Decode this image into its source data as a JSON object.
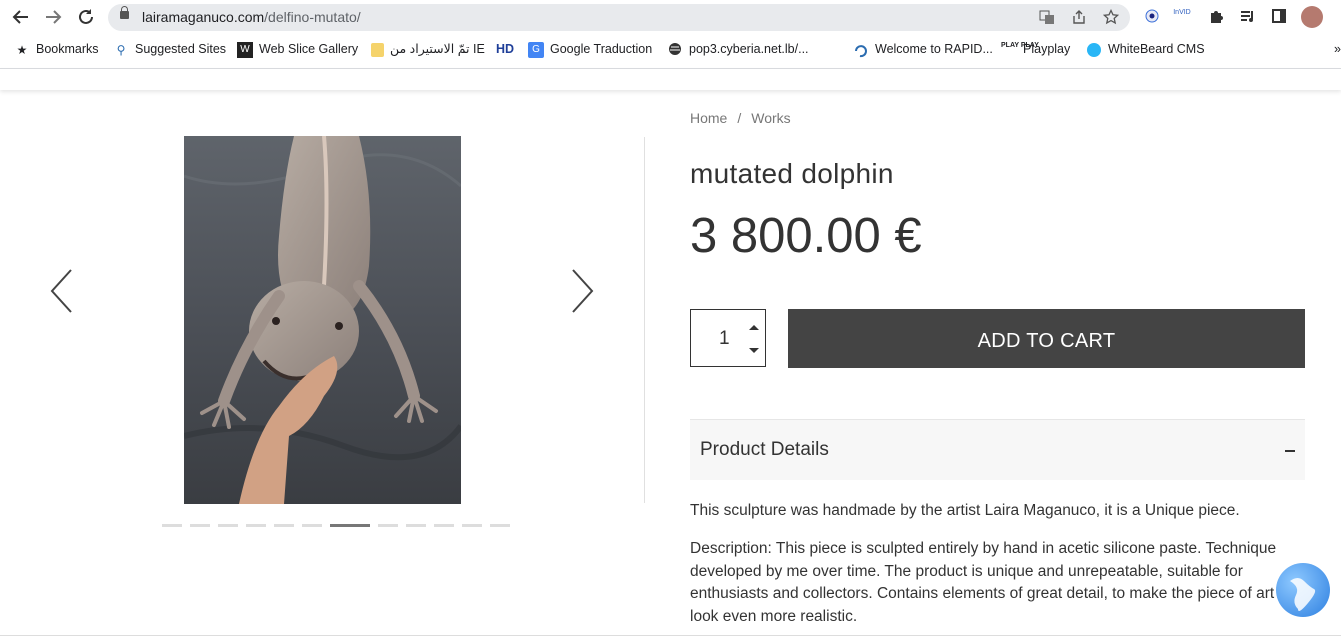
{
  "browser": {
    "url_domain": "lairamaganuco.com",
    "url_path": "/delfino-mutato/",
    "bookmarks": [
      {
        "label": "Bookmarks",
        "icon": "star-icon"
      },
      {
        "label": "Suggested Sites",
        "icon": "search-icon"
      },
      {
        "label": "Web Slice Gallery",
        "icon": "web-slice-icon"
      },
      {
        "label": "تمّ الاستيراد من IE",
        "icon": "folder-icon"
      },
      {
        "label": "HD",
        "icon": "hd-icon"
      },
      {
        "label": "Google Traduction",
        "icon": "translate-icon"
      },
      {
        "label": "pop3.cyberia.net.lb/...",
        "icon": "globe-icon"
      },
      {
        "label": "Welcome to RAPID...",
        "icon": "rapid-icon"
      },
      {
        "label": "Playplay",
        "icon": "playplay-icon"
      },
      {
        "label": "WhiteBeard CMS",
        "icon": "whitebeard-icon"
      }
    ],
    "ext_invid": "InVID"
  },
  "breadcrumb": {
    "home": "Home",
    "separator": "/",
    "current": "Works"
  },
  "product": {
    "title": "mutated dolphin",
    "price": "3 800.00 €",
    "quantity": "1",
    "add_to_cart": "ADD TO CART",
    "details_label": "Product Details",
    "description_1": "This sculpture was handmade by the artist Laira Maganuco, it is a Unique piece.",
    "description_2": "Description: This piece is sculpted entirely by hand in acetic silicone paste. Technique developed by me over time. The product is unique and unrepeatable, suitable for enthusiasts and collectors. Contains elements of great detail, to make the piece of art look even more realistic."
  },
  "gallery": {
    "slide_count": 12,
    "active_slide": 7
  }
}
